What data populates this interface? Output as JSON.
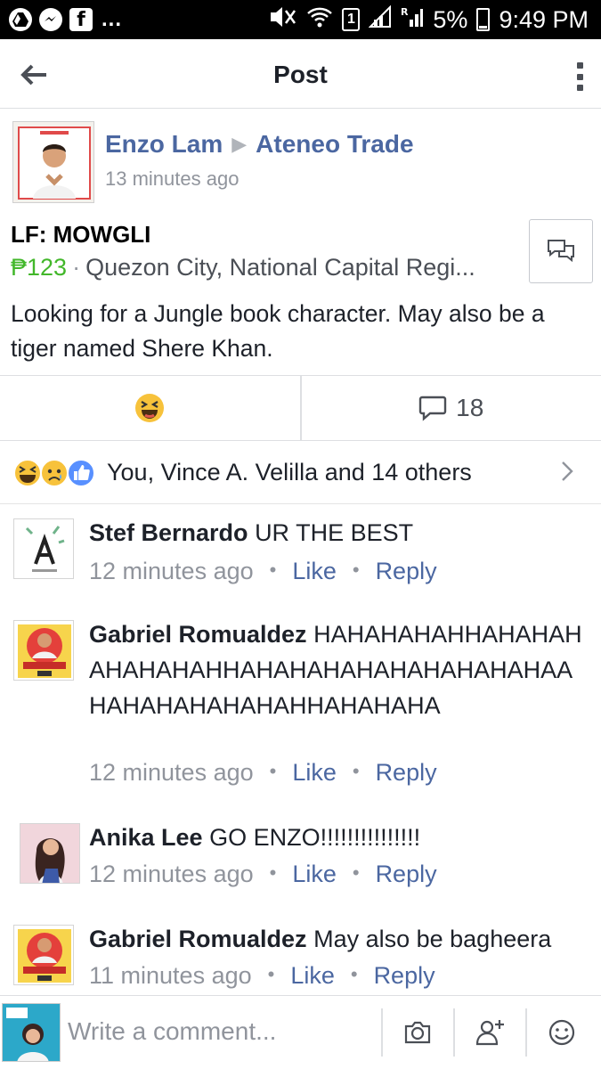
{
  "status_bar": {
    "time": "9:49 PM",
    "battery": "5%",
    "sim_label": "1",
    "more": "...",
    "icons": [
      "drive-icon",
      "messenger-icon",
      "facebook-icon",
      "mute-icon",
      "wifi-icon",
      "signal-icon",
      "roaming-signal-icon",
      "battery-icon"
    ]
  },
  "toolbar": {
    "title": "Post"
  },
  "post": {
    "author": "Enzo Lam",
    "group": "Ateneo Trade",
    "time": "13 minutes ago",
    "item_title": "LF: MOWGLI",
    "price": "₱123",
    "location": "Quezon City, National Capital Regi...",
    "body": "Looking for a Jungle book character. May also be a tiger named Shere Khan."
  },
  "actions": {
    "comment_count": "18"
  },
  "reactions": {
    "summary": "You, Vince A. Velilla and 14 others"
  },
  "comments": [
    {
      "author": "Stef Bernardo",
      "text": "UR THE BEST",
      "time": "12 minutes ago",
      "like": "Like",
      "reply": "Reply"
    },
    {
      "author": "Gabriel Romualdez",
      "text": "HAHAHAHAHHAHAHAHAHAHAHAHHAHAHAHAHAHAHAHAHAHAAHAHAHAHAHAHAHHAHAHAHA",
      "time": "12 minutes ago",
      "like": "Like",
      "reply": "Reply"
    },
    {
      "author": "Anika Lee",
      "text": "GO ENZO!!!!!!!!!!!!!!!",
      "time": "12 minutes ago",
      "like": "Like",
      "reply": "Reply"
    },
    {
      "author": "Gabriel Romualdez",
      "text": "May also be bagheera",
      "time": "11 minutes ago",
      "like": "Like",
      "reply": "Reply"
    }
  ],
  "composer": {
    "placeholder": "Write a comment..."
  },
  "colors": {
    "link": "#4b67a1",
    "meta": "#90949c",
    "price": "#42b72a",
    "like_blue": "#5890ff",
    "haha_yellow": "#f7c23b"
  }
}
